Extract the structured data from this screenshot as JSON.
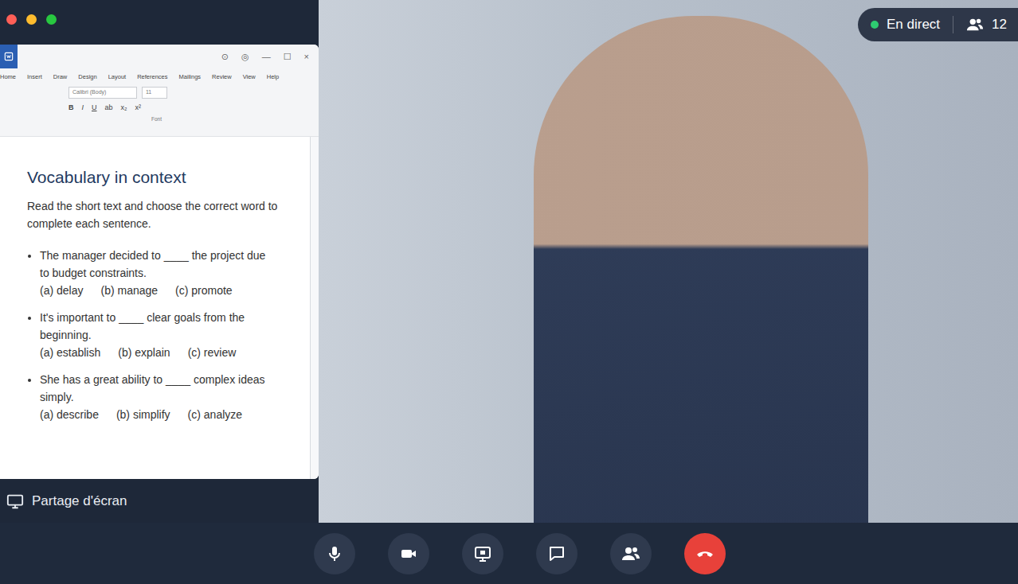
{
  "live": {
    "label": "En direct",
    "count": "12",
    "on": true
  },
  "screen_share": {
    "label": "Partage d'écran"
  },
  "document": {
    "window_controls": [
      "⊙",
      "◎",
      "—",
      "☐",
      "×"
    ],
    "ribbon_tabs": [
      "Home",
      "Insert",
      "Draw",
      "Design",
      "Layout",
      "References",
      "Mailings",
      "Review",
      "View",
      "Help"
    ],
    "font": "Calibri (Body)",
    "size": "11",
    "format_buttons": [
      "B",
      "I",
      "U",
      "ab",
      "x₂",
      "x²"
    ],
    "group_label": "Font",
    "title": "Vocabulary in context",
    "instructions": "Read the short text and choose the correct word to complete each sentence.",
    "questions": [
      {
        "text": "The manager decided to ____ the project due to budget constraints.",
        "options": [
          "(a) delay",
          "(b) manage",
          "(c) promote"
        ]
      },
      {
        "text": "It's important to ____ clear goals from the beginning.",
        "options": [
          "(a) establish",
          "(b) explain",
          "(c) review"
        ]
      },
      {
        "text": "She has a great ability to ____ complex ideas simply.",
        "options": [
          "(a) describe",
          "(b) simplify",
          "(c) analyze"
        ]
      }
    ]
  },
  "controls": [
    {
      "kind": "mic"
    },
    {
      "kind": "camera"
    },
    {
      "kind": "share"
    },
    {
      "kind": "chat"
    },
    {
      "kind": "participants"
    },
    {
      "kind": "hangup"
    }
  ]
}
